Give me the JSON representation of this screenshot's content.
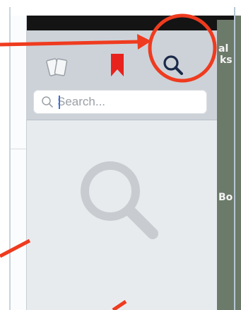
{
  "search": {
    "placeholder": "Search..."
  },
  "tabs": [
    {
      "icon": "notes-icon"
    },
    {
      "icon": "bookmark-icon",
      "color": "#e8231d"
    },
    {
      "icon": "search-icon",
      "selected": true,
      "color": "#1b2a4a"
    }
  ],
  "background_text": {
    "line1": "al",
    "line2": "ks",
    "line3": "Bo"
  },
  "colors": {
    "panel": "#e8ebee",
    "header": "#cdd2d8",
    "annotation": "#ef3b1f",
    "placeholder_icon": "#c8ccd0"
  }
}
